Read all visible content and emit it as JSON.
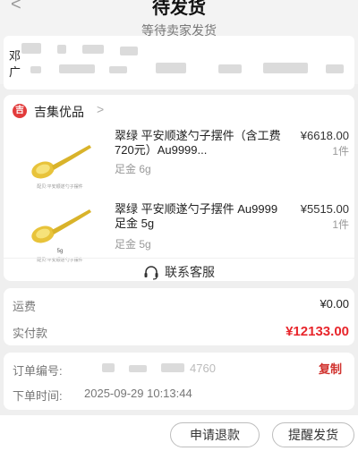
{
  "header": {
    "title": "待发货",
    "back_glyph": "<",
    "subtitle": "等待卖家发货"
  },
  "address": {
    "name_prefix": "邓",
    "line_prefix": "广"
  },
  "shop": {
    "icon_glyph": "吉",
    "name": "吉集优品",
    "chevron": ">"
  },
  "products": [
    {
      "title": "翠绿  平安顺遂勺子摆件（含工费720元）Au9999...",
      "spec": "足金 6g",
      "price": "¥6618.00",
      "qty": "1件",
      "image_caption": "配贝:平安顺遂勺子摆件"
    },
    {
      "title": "翠绿  平安顺遂勺子摆件 Au9999 足金 5g",
      "spec": "足金 5g",
      "price": "¥5515.00",
      "qty": "1件",
      "image_weight": "5g",
      "image_caption": "配贝:平安顺遂勺子摆件"
    }
  ],
  "customer_service": {
    "label": "联系客服",
    "icon": "headset-icon"
  },
  "totals": {
    "shipping_label": "运费",
    "shipping_value": "¥0.00",
    "paid_label": "实付款",
    "paid_value": "¥12133.00"
  },
  "order": {
    "number_label": "订单编号:",
    "number_partial": "4760",
    "copy_label": "复制",
    "time_label": "下单时间:",
    "time_value": "2025-09-29 10:13:44"
  },
  "actions": {
    "refund_label": "申请退款",
    "remind_label": "提醒发货"
  },
  "colors": {
    "accent_red": "#e8262c",
    "copy_red": "#d0312d",
    "shop_icon_red": "#e23b3b",
    "gold": "#e8c33a"
  }
}
